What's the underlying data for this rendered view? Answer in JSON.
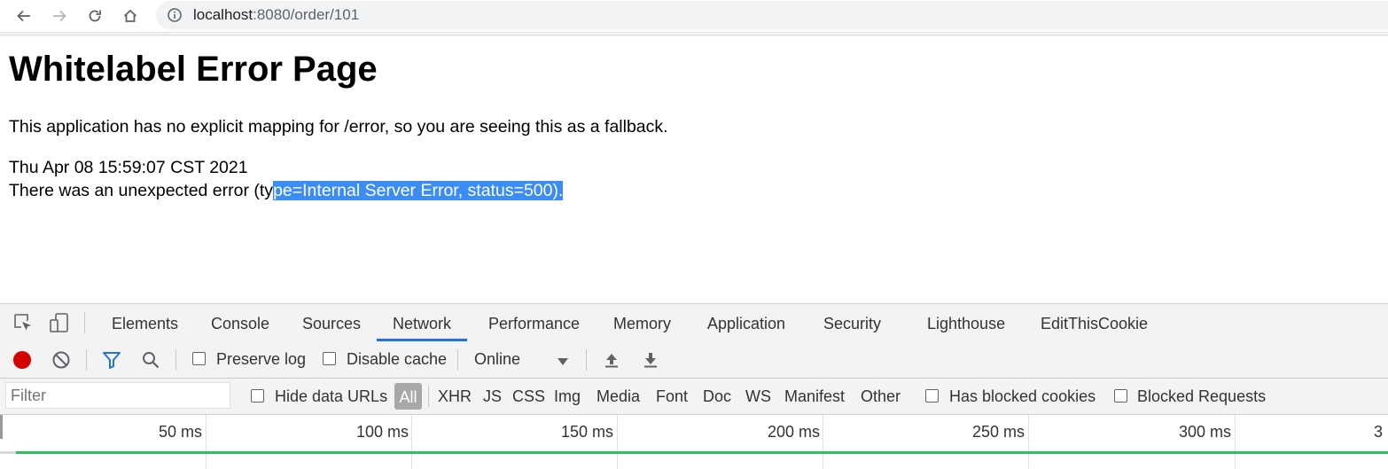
{
  "browser": {
    "url_host": "localhost",
    "url_rest": ":8080/order/101",
    "icons": [
      "back-icon",
      "forward-icon",
      "reload-icon",
      "home-icon",
      "info-icon"
    ]
  },
  "page": {
    "title": "Whitelabel Error Page",
    "description": "This application has no explicit mapping for /error, so you are seeing this as a fallback.",
    "timestamp": "Thu Apr 08 15:59:07 CST 2021",
    "error_prefix": "There was an unexpected error (ty",
    "error_selected": "pe=Internal Server Error, status=500)."
  },
  "devtools": {
    "tabs": [
      "Elements",
      "Console",
      "Sources",
      "Network",
      "Performance",
      "Memory",
      "Application",
      "Security",
      "Lighthouse",
      "EditThisCookie"
    ],
    "active_tab": "Network",
    "toolbar": {
      "preserve_log": "Preserve log",
      "disable_cache": "Disable cache",
      "throttling": "Online"
    },
    "filter_bar": {
      "filter_placeholder": "Filter",
      "hide_data_urls": "Hide data URLs",
      "all": "All",
      "types": [
        "XHR",
        "JS",
        "CSS",
        "Img",
        "Media",
        "Font",
        "Doc",
        "WS",
        "Manifest",
        "Other"
      ],
      "has_blocked_cookies": "Has blocked cookies",
      "blocked_requests": "Blocked Requests"
    },
    "timeline_ticks": [
      "50 ms",
      "100 ms",
      "150 ms",
      "200 ms",
      "250 ms",
      "300 ms",
      "3"
    ]
  },
  "colors": {
    "selection": "#3b8df5",
    "active_tab_underline": "#1a73e8",
    "record": "#d50000",
    "filter_active": "#1a73e8",
    "timeline_line": "#26c552"
  }
}
